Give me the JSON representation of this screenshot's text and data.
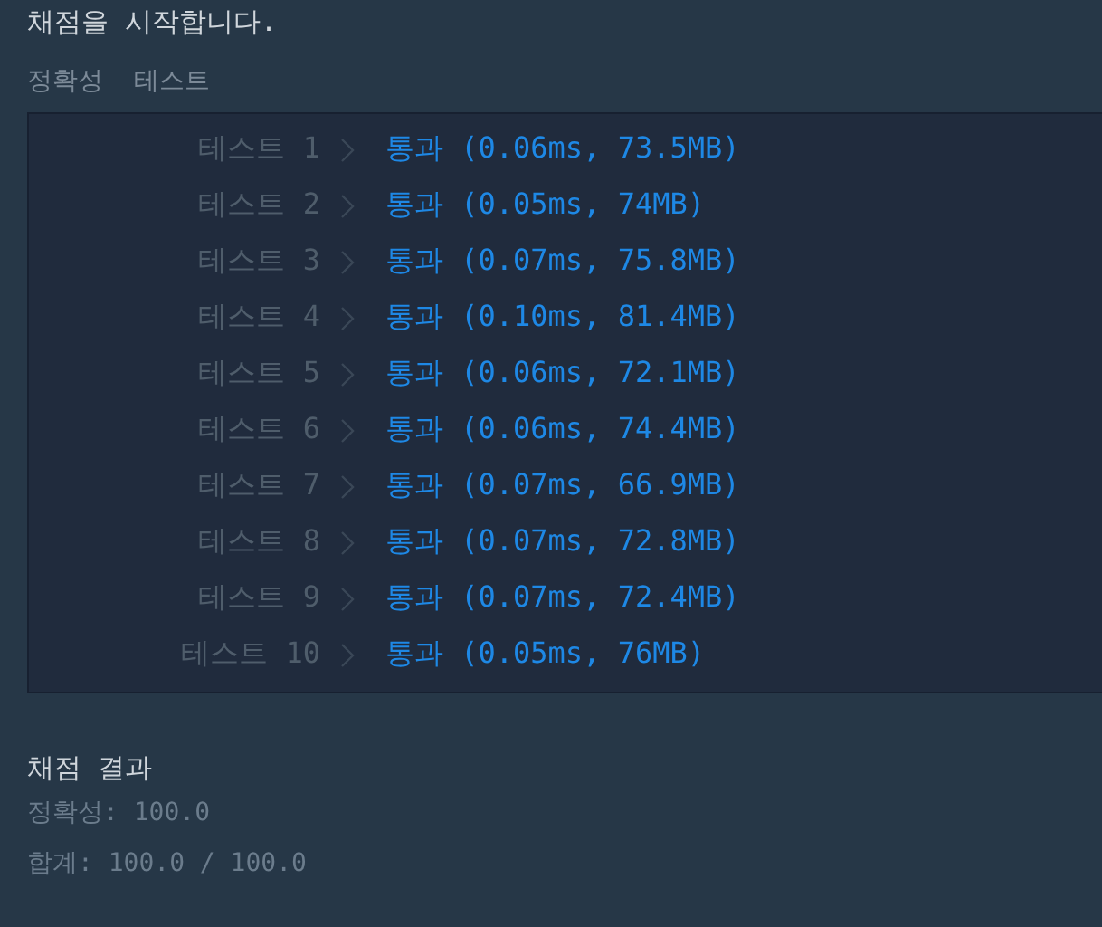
{
  "header": "채점을 시작합니다.",
  "section_title": "정확성  테스트",
  "tests": [
    {
      "label": "테스트 1",
      "result": "통과 (0.06ms, 73.5MB)"
    },
    {
      "label": "테스트 2",
      "result": "통과 (0.05ms, 74MB)"
    },
    {
      "label": "테스트 3",
      "result": "통과 (0.07ms, 75.8MB)"
    },
    {
      "label": "테스트 4",
      "result": "통과 (0.10ms, 81.4MB)"
    },
    {
      "label": "테스트 5",
      "result": "통과 (0.06ms, 72.1MB)"
    },
    {
      "label": "테스트 6",
      "result": "통과 (0.06ms, 74.4MB)"
    },
    {
      "label": "테스트 7",
      "result": "통과 (0.07ms, 66.9MB)"
    },
    {
      "label": "테스트 8",
      "result": "통과 (0.07ms, 72.8MB)"
    },
    {
      "label": "테스트 9",
      "result": "통과 (0.07ms, 72.4MB)"
    },
    {
      "label": "테스트 10",
      "result": "통과 (0.05ms, 76MB)"
    }
  ],
  "summary_title": "채점 결과",
  "summary_lines": [
    "정확성: 100.0",
    "합계: 100.0 / 100.0"
  ]
}
